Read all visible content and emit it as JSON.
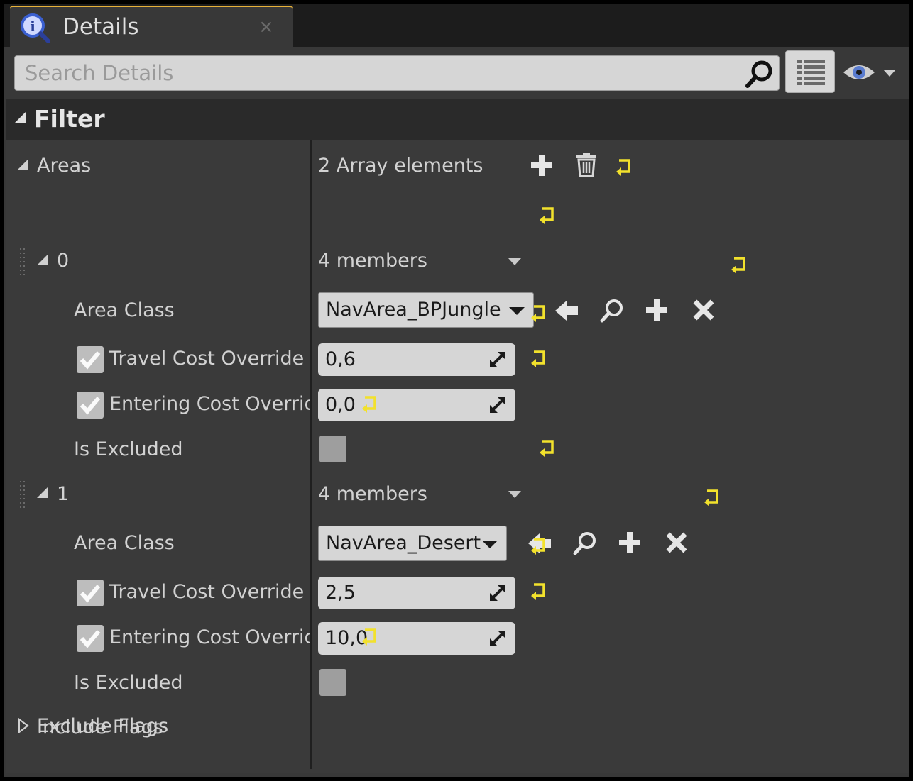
{
  "tab": {
    "title": "Details",
    "close": "×",
    "icon": "info-magnifier-icon"
  },
  "search": {
    "placeholder": "Search Details",
    "icon": "search-icon"
  },
  "toolbar": {
    "view_options_icon": "grid-list-icon",
    "visibility_icon": "eye-icon"
  },
  "filter": {
    "label": "Filter"
  },
  "areas": {
    "label": "Areas",
    "summary": "2 Array elements",
    "elements": [
      {
        "index": "0",
        "members": "4 members",
        "area_class_label": "Area Class",
        "area_class_value": "NavArea_BPJungle",
        "travel_label": "Travel Cost Override",
        "travel_value": "0,6",
        "travel_checked": true,
        "entering_label": "Entering Cost Overrid",
        "entering_value": "0,0",
        "entering_checked": true,
        "excluded_label": "Is Excluded",
        "excluded_checked": false
      },
      {
        "index": "1",
        "members": "4 members",
        "area_class_label": "Area Class",
        "area_class_value": "NavArea_Desert",
        "travel_label": "Travel Cost Override",
        "travel_value": "2,5",
        "travel_checked": true,
        "entering_label": "Entering Cost Overrid",
        "entering_value": "10,0",
        "entering_checked": true,
        "excluded_label": "Is Excluded",
        "excluded_checked": false
      }
    ]
  },
  "include_flags": {
    "label": "Include Flags"
  },
  "exclude_flags": {
    "label": "Exclude Flags"
  },
  "colors": {
    "accent": "#e8b23a",
    "reset_yellow": "#f2e12c",
    "panel": "#383838"
  }
}
